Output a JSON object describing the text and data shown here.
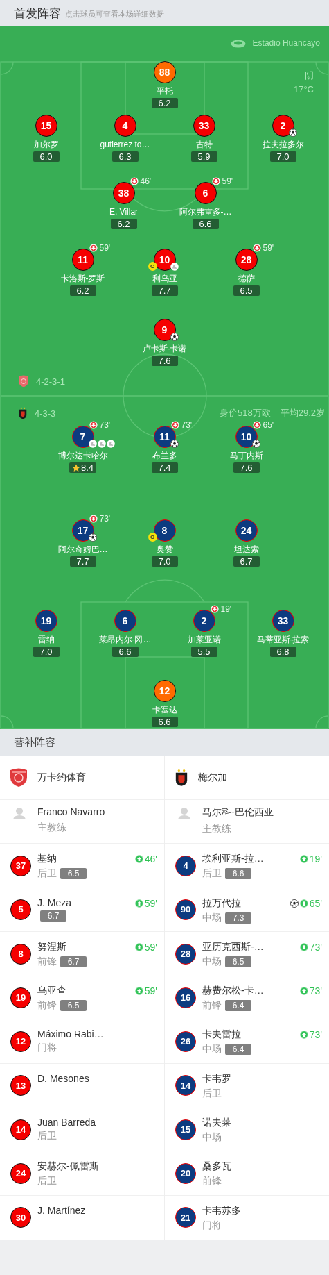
{
  "header": {
    "title": "首发阵容",
    "hint": "点击球员可查看本场详细数据"
  },
  "match": {
    "venue": "Estadio Huancayo",
    "weather": "阴",
    "temperature": "17°C"
  },
  "home": {
    "kind": "home",
    "formation": "4-2-3-1",
    "lines": [
      {
        "players": [
          {
            "kind": "goalkeeper",
            "number": "88",
            "name": "平托",
            "rating": "6.2"
          }
        ]
      },
      {
        "players": [
          {
            "kind": "outfield",
            "number": "15",
            "name": "加尔罗",
            "rating": "6.0"
          },
          {
            "kind": "outfield",
            "number": "4",
            "name": "gutierrez to…",
            "rating": "6.3"
          },
          {
            "kind": "outfield",
            "number": "33",
            "name": "古特",
            "rating": "5.9"
          },
          {
            "kind": "outfield",
            "number": "2",
            "name": "拉夫拉多尔",
            "rating": "7.0",
            "events": [
              {
                "kind": "goal"
              }
            ]
          }
        ]
      },
      {
        "players": [
          {
            "kind": "outfield",
            "number": "38",
            "name": "E. Villar",
            "rating": "6.2",
            "sub_off": "46'"
          },
          {
            "kind": "outfield",
            "number": "6",
            "name": "阿尔弗雷多-…",
            "rating": "6.6",
            "sub_off": "59'"
          }
        ]
      },
      {
        "players": [
          {
            "kind": "outfield",
            "number": "11",
            "name": "卡洛斯-罗斯",
            "rating": "6.2",
            "sub_off": "59'"
          },
          {
            "kind": "outfield",
            "number": "10",
            "name": "利乌亚",
            "rating": "7.7",
            "captain": "C",
            "events": [
              {
                "kind": "assist"
              }
            ]
          },
          {
            "kind": "outfield",
            "number": "28",
            "name": "德萨",
            "rating": "6.5",
            "sub_off": "59'"
          }
        ]
      },
      {
        "players": [
          {
            "kind": "outfield",
            "number": "9",
            "name": "卢卡斯-卡诺",
            "rating": "7.6",
            "events": [
              {
                "kind": "goal"
              }
            ]
          }
        ]
      }
    ]
  },
  "away": {
    "kind": "away",
    "formation": "4-3-3",
    "market_value": "身价518万欧",
    "average_age": "平均29.2岁",
    "lines": [
      {
        "players": [
          {
            "kind": "outfield",
            "number": "7",
            "name": "博尔达卡哈尔",
            "rating": "8.4",
            "top_rated": true,
            "sub_off": "73'",
            "events": [
              {
                "kind": "assist"
              },
              {
                "kind": "assist"
              },
              {
                "kind": "assist"
              }
            ]
          },
          {
            "kind": "outfield",
            "number": "11",
            "name": "布兰多",
            "rating": "7.4",
            "sub_off": "73'",
            "events": [
              {
                "kind": "goal"
              }
            ]
          },
          {
            "kind": "outfield",
            "number": "10",
            "name": "马丁内斯",
            "rating": "7.6",
            "sub_off": "65'",
            "events": [
              {
                "kind": "goal"
              }
            ]
          }
        ]
      },
      {
        "players": [
          {
            "kind": "outfield",
            "number": "17",
            "name": "阿尔奇姆巴…",
            "rating": "7.7",
            "sub_off": "73'",
            "events": [
              {
                "kind": "goal"
              }
            ]
          },
          {
            "kind": "outfield",
            "number": "8",
            "name": "奥赞",
            "rating": "7.0",
            "captain": "C"
          },
          {
            "kind": "outfield",
            "number": "24",
            "name": "坦达索",
            "rating": "6.7"
          }
        ]
      },
      {
        "players": [
          {
            "kind": "outfield",
            "number": "19",
            "name": "雷纳",
            "rating": "7.0"
          },
          {
            "kind": "outfield",
            "number": "6",
            "name": "莱昂内尔-冈…",
            "rating": "6.6"
          },
          {
            "kind": "outfield",
            "number": "2",
            "name": "加莱亚诺",
            "rating": "5.5",
            "sub_off": "19'"
          },
          {
            "kind": "outfield",
            "number": "33",
            "name": "马蒂亚斯-拉索",
            "rating": "6.8"
          }
        ]
      },
      {
        "players": [
          {
            "kind": "goalkeeper",
            "number": "12",
            "name": "卡塞达",
            "rating": "6.6"
          }
        ]
      }
    ]
  },
  "substitutes": {
    "title": "替补阵容",
    "teams": [
      {
        "kind": "home",
        "name": "万卡约体育",
        "coach": {
          "name": "Franco Navarro",
          "role": "主教练"
        },
        "players": [
          {
            "number": "37",
            "name": "基纳",
            "position": "后卫",
            "rating": "6.5",
            "sub_on": "46'"
          },
          {
            "number": "5",
            "name": "J. Meza",
            "rating": "6.7",
            "sub_on": "59'"
          },
          {
            "number": "8",
            "name": "努涅斯",
            "position": "前锋",
            "rating": "6.7",
            "sub_on": "59'"
          },
          {
            "number": "19",
            "name": "乌亚查",
            "position": "前锋",
            "rating": "6.5",
            "sub_on": "59'"
          },
          {
            "number": "12",
            "name": "Máximo Rabi…",
            "position": "门将"
          },
          {
            "number": "13",
            "name": "D. Mesones"
          },
          {
            "number": "14",
            "name": "Juan Barreda",
            "position": "后卫"
          },
          {
            "number": "24",
            "name": "安赫尔-佩雷斯",
            "position": "后卫"
          },
          {
            "number": "30",
            "name": "J. Martínez"
          }
        ]
      },
      {
        "kind": "away",
        "name": "梅尔加",
        "coach": {
          "name": "马尔科-巴伦西亚",
          "role": "主教练"
        },
        "players": [
          {
            "number": "4",
            "name": "埃利亚斯-拉…",
            "position": "后卫",
            "rating": "6.6",
            "sub_on": "19'"
          },
          {
            "number": "90",
            "name": "拉万代拉",
            "position": "中场",
            "rating": "7.3",
            "sub_on": "65'",
            "goal": true
          },
          {
            "number": "28",
            "name": "亚历克西斯-…",
            "position": "中场",
            "rating": "6.5",
            "sub_on": "73'"
          },
          {
            "number": "16",
            "name": "赫费尔松-卡…",
            "position": "前锋",
            "rating": "6.4",
            "sub_on": "73'"
          },
          {
            "number": "26",
            "name": "卡夫雷拉",
            "position": "中场",
            "rating": "6.4",
            "sub_on": "73'"
          },
          {
            "number": "14",
            "name": "卡韦罗",
            "position": "后卫"
          },
          {
            "number": "15",
            "name": "诺夫莱",
            "position": "中场"
          },
          {
            "number": "20",
            "name": "桑多瓦",
            "position": "前锋"
          },
          {
            "number": "21",
            "name": "卡韦苏多",
            "position": "门将"
          }
        ]
      }
    ]
  }
}
